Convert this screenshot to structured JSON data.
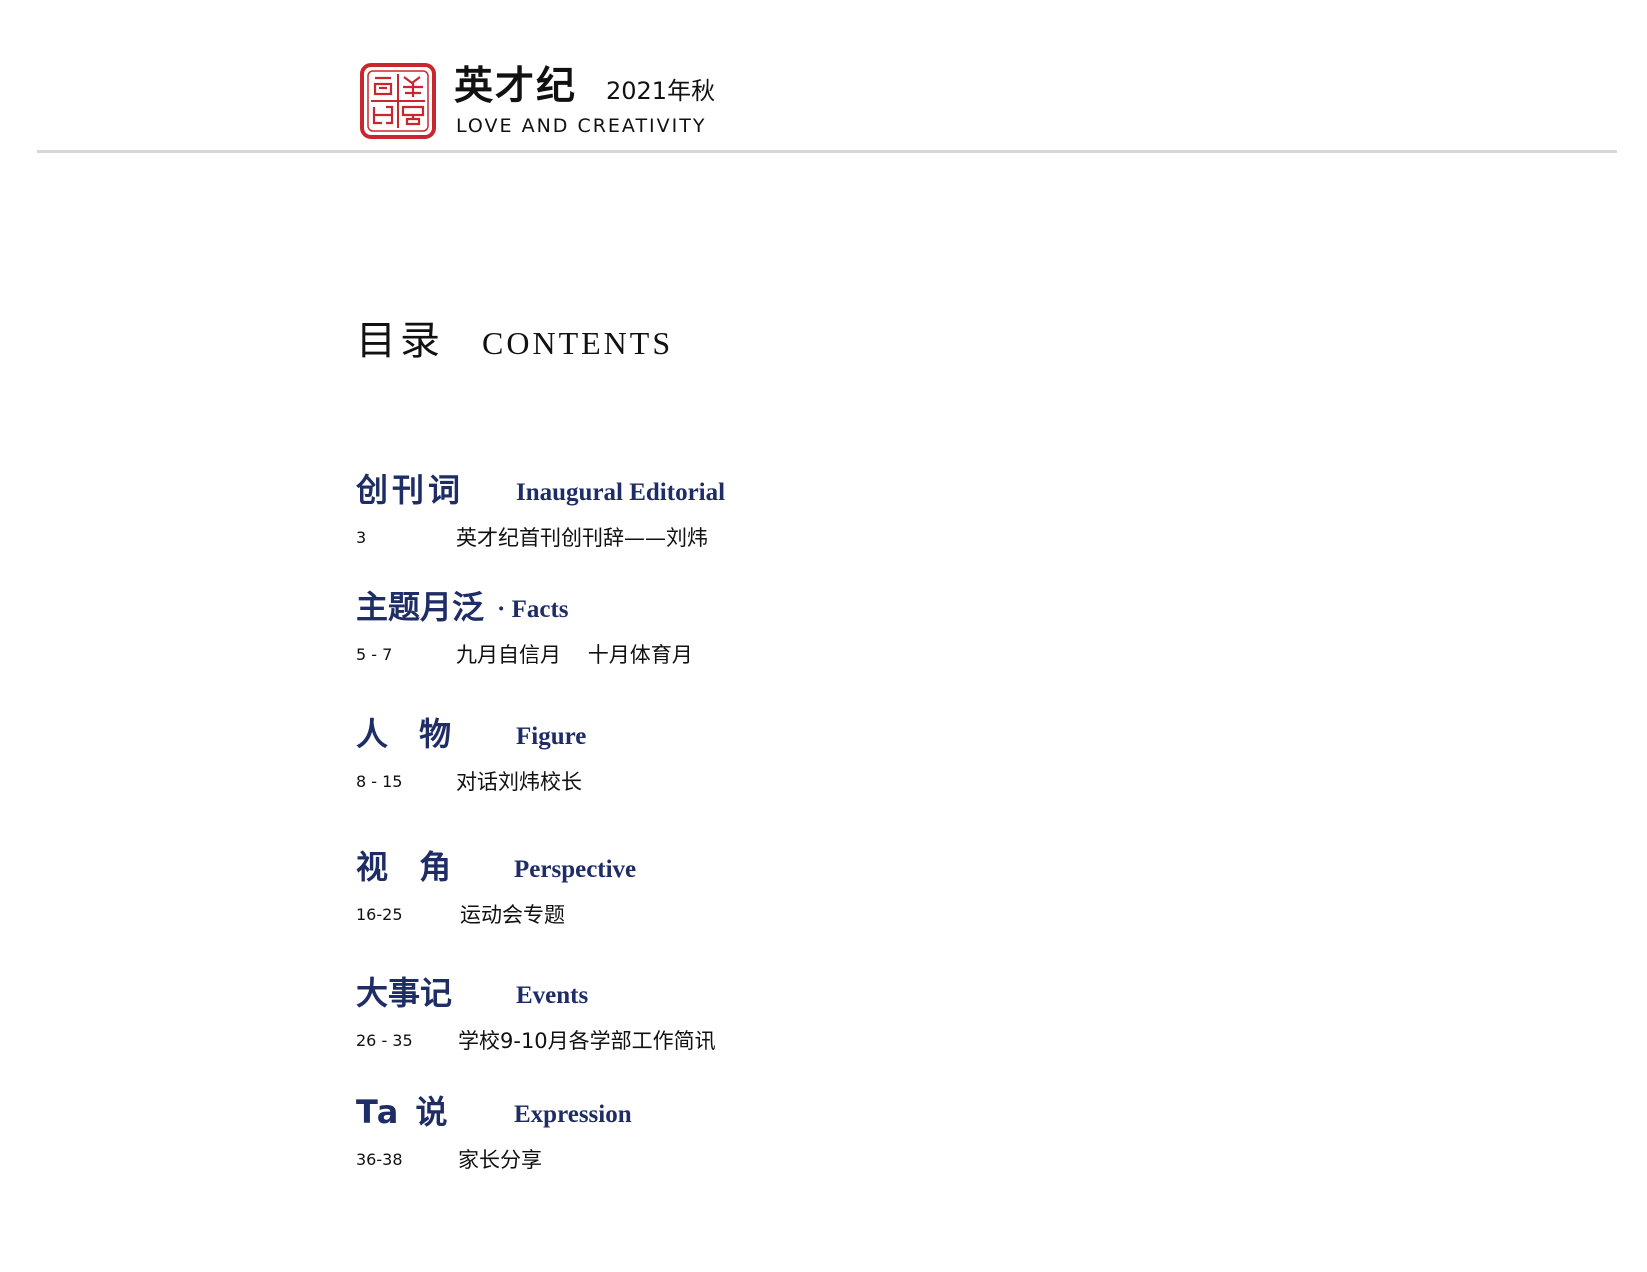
{
  "header": {
    "title": "英才纪",
    "edition": "2021年秋",
    "tagline": "LOVE AND CREATIVITY",
    "seal_icon": "seal-stamp-icon",
    "seal_color": "#c8282d"
  },
  "toc": {
    "heading_cn": "目录",
    "heading_en": "CONTENTS",
    "sections": [
      {
        "title_cn": "创刊词",
        "title_en": "Inaugural Editorial",
        "pages": "3",
        "description": "英才纪首刊创刊辞——刘炜"
      },
      {
        "title_cn": "主题月泛",
        "title_en": "· Facts",
        "pages": "5 - 7",
        "description": "九月自信月    十月体育月"
      },
      {
        "title_cn": "人 物",
        "title_en": "Figure",
        "pages": "8 - 15",
        "description": "对话刘炜校长"
      },
      {
        "title_cn": "视 角",
        "title_en": "Perspective",
        "pages": "16-25",
        "description": "运动会专题"
      },
      {
        "title_cn": "大事记",
        "title_en": "Events",
        "pages": "26 - 35",
        "description": "学校9-10月各学部工作简讯"
      },
      {
        "title_cn": "Ta 说",
        "title_en": "Expression",
        "pages": "36-38",
        "description": "家长分享"
      }
    ]
  },
  "colors": {
    "accent_navy": "#1f2d66",
    "rule_gray": "#d6d6d6",
    "text": "#111111"
  }
}
